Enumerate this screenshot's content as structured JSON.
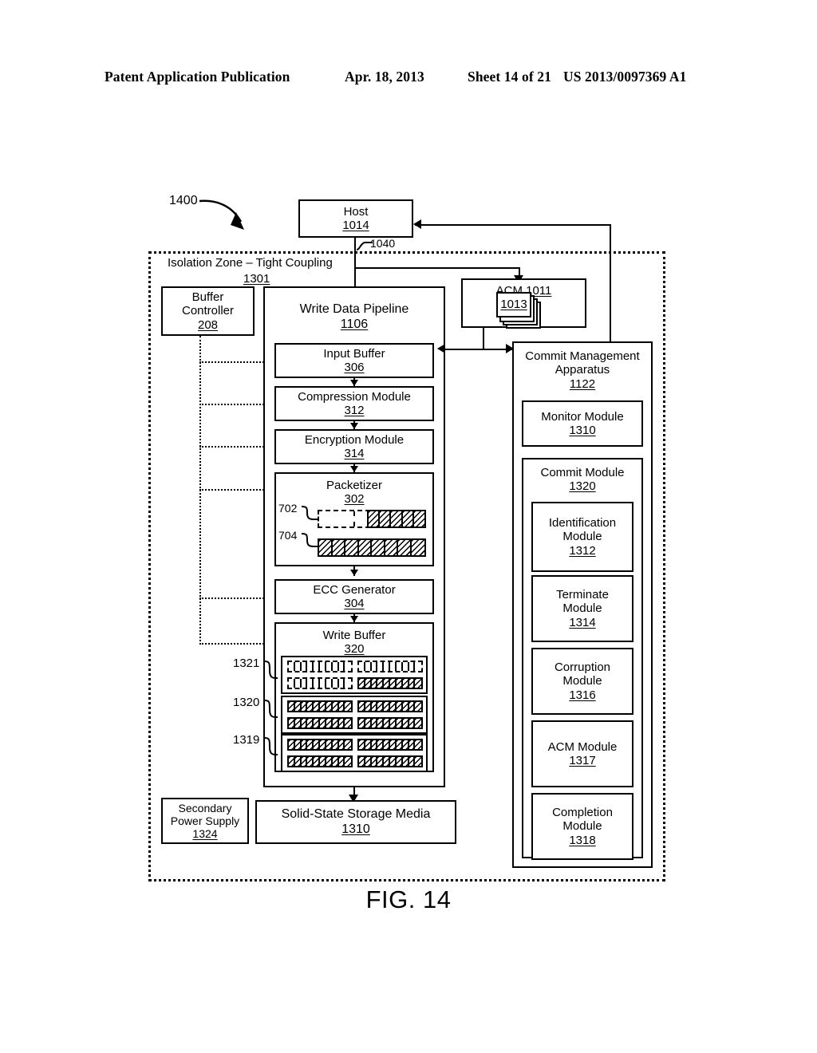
{
  "header": {
    "publication": "Patent Application Publication",
    "date": "Apr. 18, 2013",
    "sheet": "Sheet 14 of 21",
    "number": "US 2013/0097369 A1"
  },
  "figure": {
    "caption": "FIG. 14",
    "diagram_ref": "1400"
  },
  "host": {
    "title": "Host",
    "ref": "1014"
  },
  "connections": {
    "host_to_zone": "1040"
  },
  "isolation_zone": {
    "title": "Isolation Zone – Tight Coupling",
    "ref": "1301"
  },
  "buffer_controller": {
    "line1": "Buffer",
    "line2": "Controller",
    "ref": "208"
  },
  "write_data_pipeline": {
    "title": "Write Data Pipeline",
    "ref": "1106",
    "stages": [
      {
        "title": "Input Buffer",
        "ref": "306"
      },
      {
        "title": "Compression Module",
        "ref": "312"
      },
      {
        "title": "Encryption Module",
        "ref": "314"
      },
      {
        "title": "Packetizer",
        "ref": "302"
      },
      {
        "title": "ECC Generator",
        "ref": "304"
      },
      {
        "title": "Write Buffer",
        "ref": "320"
      }
    ]
  },
  "packetizer_detail": {
    "row_labels": [
      "702",
      "704"
    ],
    "rows": [
      {
        "ref": "702",
        "empty_cells": 3,
        "filled_cells": 5,
        "style": "dashed"
      },
      {
        "ref": "704",
        "empty_cells": 0,
        "filled_cells": 8,
        "style": "solid"
      }
    ]
  },
  "write_buffer_detail": {
    "group_labels": [
      "1321",
      "1320",
      "1319"
    ],
    "groups": [
      {
        "ref": "1321",
        "rows": [
          [
            "empty",
            "empty"
          ],
          [
            "empty",
            "filled"
          ]
        ]
      },
      {
        "ref": "1320",
        "rows": [
          [
            "filled",
            "filled"
          ],
          [
            "filled",
            "filled"
          ]
        ]
      },
      {
        "ref": "1319",
        "rows": [
          [
            "filled",
            "filled"
          ],
          [
            "filled",
            "filled"
          ]
        ]
      }
    ]
  },
  "acm": {
    "title": "ACM",
    "ref": "1011",
    "inner_ref": "1013"
  },
  "commit_management_apparatus": {
    "line1": "Commit Management",
    "line2": "Apparatus",
    "ref": "1122",
    "monitor_module": {
      "title": "Monitor Module",
      "ref": "1310"
    },
    "commit_module": {
      "title": "Commit Module",
      "ref": "1320",
      "submodules": [
        {
          "line1": "Identification",
          "line2": "Module",
          "ref": "1312"
        },
        {
          "line1": "Terminate",
          "line2": "Module",
          "ref": "1314"
        },
        {
          "line1": "Corruption",
          "line2": "Module",
          "ref": "1316"
        },
        {
          "line1": "ACM Module",
          "line2": "",
          "ref": "1317"
        },
        {
          "line1": "Completion",
          "line2": "Module",
          "ref": "1318"
        }
      ]
    }
  },
  "secondary_power_supply": {
    "line1": "Secondary",
    "line2": "Power Supply",
    "ref": "1324"
  },
  "solid_state_storage_media": {
    "title": "Solid-State Storage Media",
    "ref": "1310"
  }
}
